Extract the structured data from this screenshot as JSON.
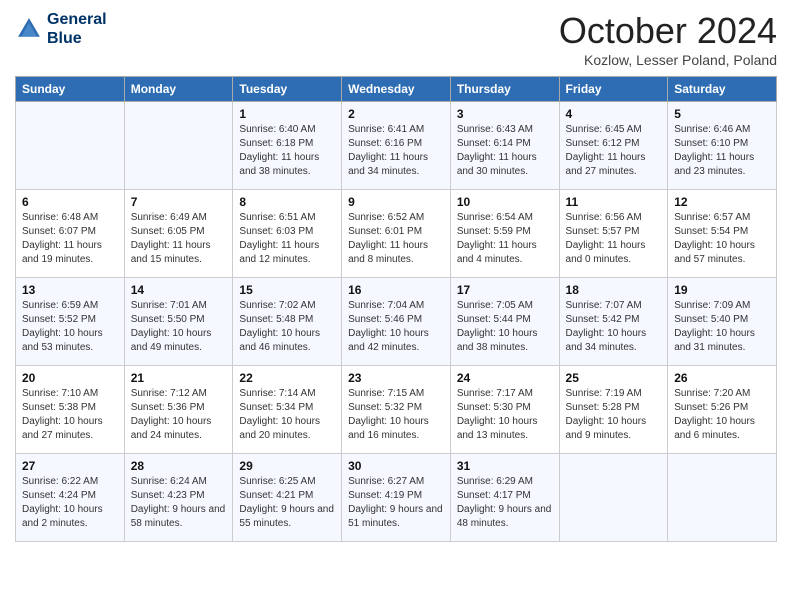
{
  "header": {
    "logo_line1": "General",
    "logo_line2": "Blue",
    "month_title": "October 2024",
    "subtitle": "Kozlow, Lesser Poland, Poland"
  },
  "weekdays": [
    "Sunday",
    "Monday",
    "Tuesday",
    "Wednesday",
    "Thursday",
    "Friday",
    "Saturday"
  ],
  "weeks": [
    [
      {
        "day": "",
        "sunrise": "",
        "sunset": "",
        "daylight": ""
      },
      {
        "day": "",
        "sunrise": "",
        "sunset": "",
        "daylight": ""
      },
      {
        "day": "1",
        "sunrise": "Sunrise: 6:40 AM",
        "sunset": "Sunset: 6:18 PM",
        "daylight": "Daylight: 11 hours and 38 minutes."
      },
      {
        "day": "2",
        "sunrise": "Sunrise: 6:41 AM",
        "sunset": "Sunset: 6:16 PM",
        "daylight": "Daylight: 11 hours and 34 minutes."
      },
      {
        "day": "3",
        "sunrise": "Sunrise: 6:43 AM",
        "sunset": "Sunset: 6:14 PM",
        "daylight": "Daylight: 11 hours and 30 minutes."
      },
      {
        "day": "4",
        "sunrise": "Sunrise: 6:45 AM",
        "sunset": "Sunset: 6:12 PM",
        "daylight": "Daylight: 11 hours and 27 minutes."
      },
      {
        "day": "5",
        "sunrise": "Sunrise: 6:46 AM",
        "sunset": "Sunset: 6:10 PM",
        "daylight": "Daylight: 11 hours and 23 minutes."
      }
    ],
    [
      {
        "day": "6",
        "sunrise": "Sunrise: 6:48 AM",
        "sunset": "Sunset: 6:07 PM",
        "daylight": "Daylight: 11 hours and 19 minutes."
      },
      {
        "day": "7",
        "sunrise": "Sunrise: 6:49 AM",
        "sunset": "Sunset: 6:05 PM",
        "daylight": "Daylight: 11 hours and 15 minutes."
      },
      {
        "day": "8",
        "sunrise": "Sunrise: 6:51 AM",
        "sunset": "Sunset: 6:03 PM",
        "daylight": "Daylight: 11 hours and 12 minutes."
      },
      {
        "day": "9",
        "sunrise": "Sunrise: 6:52 AM",
        "sunset": "Sunset: 6:01 PM",
        "daylight": "Daylight: 11 hours and 8 minutes."
      },
      {
        "day": "10",
        "sunrise": "Sunrise: 6:54 AM",
        "sunset": "Sunset: 5:59 PM",
        "daylight": "Daylight: 11 hours and 4 minutes."
      },
      {
        "day": "11",
        "sunrise": "Sunrise: 6:56 AM",
        "sunset": "Sunset: 5:57 PM",
        "daylight": "Daylight: 11 hours and 0 minutes."
      },
      {
        "day": "12",
        "sunrise": "Sunrise: 6:57 AM",
        "sunset": "Sunset: 5:54 PM",
        "daylight": "Daylight: 10 hours and 57 minutes."
      }
    ],
    [
      {
        "day": "13",
        "sunrise": "Sunrise: 6:59 AM",
        "sunset": "Sunset: 5:52 PM",
        "daylight": "Daylight: 10 hours and 53 minutes."
      },
      {
        "day": "14",
        "sunrise": "Sunrise: 7:01 AM",
        "sunset": "Sunset: 5:50 PM",
        "daylight": "Daylight: 10 hours and 49 minutes."
      },
      {
        "day": "15",
        "sunrise": "Sunrise: 7:02 AM",
        "sunset": "Sunset: 5:48 PM",
        "daylight": "Daylight: 10 hours and 46 minutes."
      },
      {
        "day": "16",
        "sunrise": "Sunrise: 7:04 AM",
        "sunset": "Sunset: 5:46 PM",
        "daylight": "Daylight: 10 hours and 42 minutes."
      },
      {
        "day": "17",
        "sunrise": "Sunrise: 7:05 AM",
        "sunset": "Sunset: 5:44 PM",
        "daylight": "Daylight: 10 hours and 38 minutes."
      },
      {
        "day": "18",
        "sunrise": "Sunrise: 7:07 AM",
        "sunset": "Sunset: 5:42 PM",
        "daylight": "Daylight: 10 hours and 34 minutes."
      },
      {
        "day": "19",
        "sunrise": "Sunrise: 7:09 AM",
        "sunset": "Sunset: 5:40 PM",
        "daylight": "Daylight: 10 hours and 31 minutes."
      }
    ],
    [
      {
        "day": "20",
        "sunrise": "Sunrise: 7:10 AM",
        "sunset": "Sunset: 5:38 PM",
        "daylight": "Daylight: 10 hours and 27 minutes."
      },
      {
        "day": "21",
        "sunrise": "Sunrise: 7:12 AM",
        "sunset": "Sunset: 5:36 PM",
        "daylight": "Daylight: 10 hours and 24 minutes."
      },
      {
        "day": "22",
        "sunrise": "Sunrise: 7:14 AM",
        "sunset": "Sunset: 5:34 PM",
        "daylight": "Daylight: 10 hours and 20 minutes."
      },
      {
        "day": "23",
        "sunrise": "Sunrise: 7:15 AM",
        "sunset": "Sunset: 5:32 PM",
        "daylight": "Daylight: 10 hours and 16 minutes."
      },
      {
        "day": "24",
        "sunrise": "Sunrise: 7:17 AM",
        "sunset": "Sunset: 5:30 PM",
        "daylight": "Daylight: 10 hours and 13 minutes."
      },
      {
        "day": "25",
        "sunrise": "Sunrise: 7:19 AM",
        "sunset": "Sunset: 5:28 PM",
        "daylight": "Daylight: 10 hours and 9 minutes."
      },
      {
        "day": "26",
        "sunrise": "Sunrise: 7:20 AM",
        "sunset": "Sunset: 5:26 PM",
        "daylight": "Daylight: 10 hours and 6 minutes."
      }
    ],
    [
      {
        "day": "27",
        "sunrise": "Sunrise: 6:22 AM",
        "sunset": "Sunset: 4:24 PM",
        "daylight": "Daylight: 10 hours and 2 minutes."
      },
      {
        "day": "28",
        "sunrise": "Sunrise: 6:24 AM",
        "sunset": "Sunset: 4:23 PM",
        "daylight": "Daylight: 9 hours and 58 minutes."
      },
      {
        "day": "29",
        "sunrise": "Sunrise: 6:25 AM",
        "sunset": "Sunset: 4:21 PM",
        "daylight": "Daylight: 9 hours and 55 minutes."
      },
      {
        "day": "30",
        "sunrise": "Sunrise: 6:27 AM",
        "sunset": "Sunset: 4:19 PM",
        "daylight": "Daylight: 9 hours and 51 minutes."
      },
      {
        "day": "31",
        "sunrise": "Sunrise: 6:29 AM",
        "sunset": "Sunset: 4:17 PM",
        "daylight": "Daylight: 9 hours and 48 minutes."
      },
      {
        "day": "",
        "sunrise": "",
        "sunset": "",
        "daylight": ""
      },
      {
        "day": "",
        "sunrise": "",
        "sunset": "",
        "daylight": ""
      }
    ]
  ]
}
